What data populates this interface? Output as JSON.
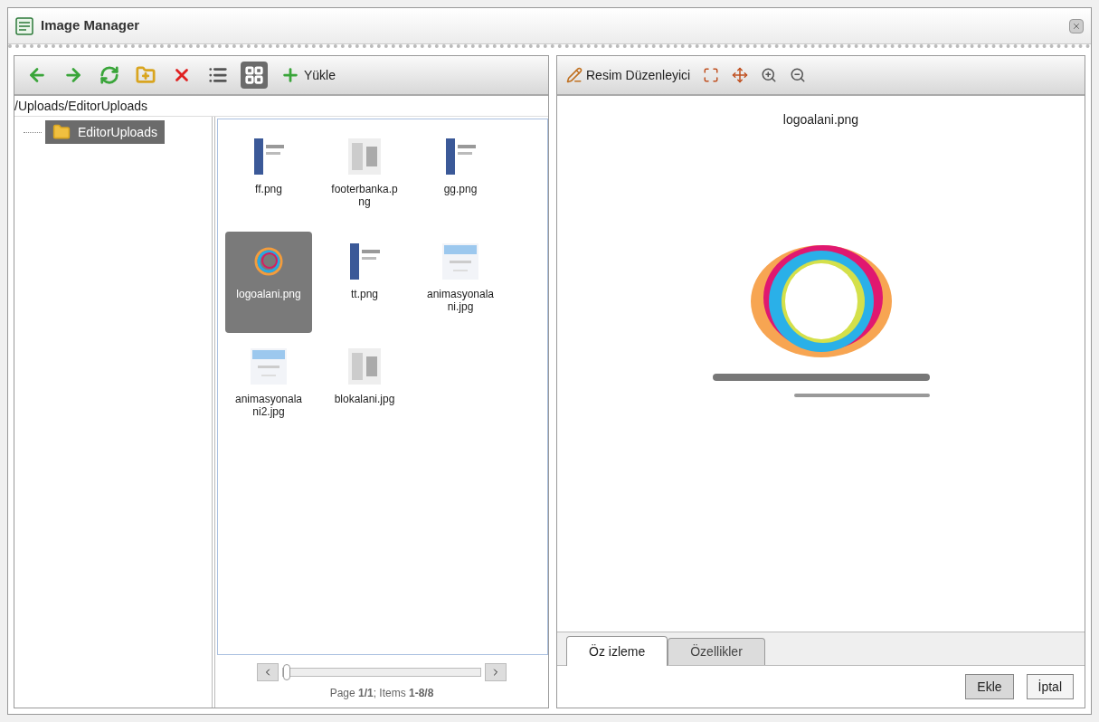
{
  "window": {
    "title": "Image Manager"
  },
  "left_toolbar": [
    {
      "kind": "back",
      "selected": false
    },
    {
      "kind": "forward",
      "selected": false
    },
    {
      "kind": "refresh",
      "selected": false
    },
    {
      "kind": "new-folder",
      "selected": false
    },
    {
      "kind": "delete",
      "selected": false
    },
    {
      "kind": "list-view",
      "selected": false
    },
    {
      "kind": "grid-view",
      "selected": true
    },
    {
      "kind": "upload",
      "selected": false,
      "label": "Yükle"
    }
  ],
  "path": "/Uploads/EditorUploads",
  "tree": [
    {
      "label": "EditorUploads",
      "selected": true
    }
  ],
  "files": [
    {
      "name": "ff.png",
      "selected": false
    },
    {
      "name": "footerbanka.png",
      "selected": false
    },
    {
      "name": "gg.png",
      "selected": false
    },
    {
      "name": "logoalani.png",
      "selected": true
    },
    {
      "name": "tt.png",
      "selected": false
    },
    {
      "name": "animasyonalani.jpg",
      "selected": false
    },
    {
      "name": "animasyonalani2.jpg",
      "selected": false
    },
    {
      "name": "blokalani.jpg",
      "selected": false
    }
  ],
  "pager_slider": {
    "level": 0
  },
  "pager": "Page **1/1**; Items **1-8/8**",
  "right_toolbar": {
    "editor_button": "Resim Düzenleyici"
  },
  "preview": {
    "file_name": "logoalani.png"
  },
  "tabs": [
    {
      "label": "Öz izleme",
      "selected": true
    },
    {
      "label": "Özellikler",
      "selected": false
    }
  ],
  "buttons": [
    "Ekle",
    "İptal"
  ]
}
